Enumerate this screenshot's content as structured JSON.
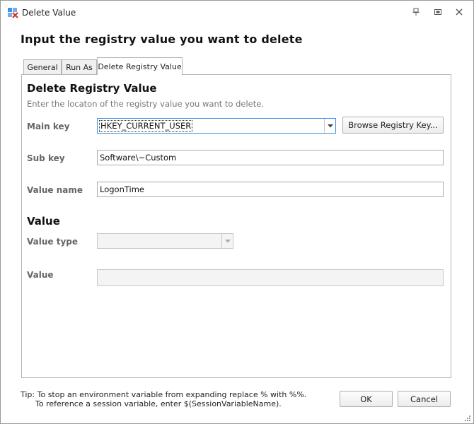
{
  "window": {
    "title": "Delete Value"
  },
  "heading": "Input the registry value you want to delete",
  "tabs": [
    {
      "label": "General"
    },
    {
      "label": "Run As"
    },
    {
      "label": "Delete Registry Value"
    }
  ],
  "registry_section": {
    "title": "Delete Registry Value",
    "description": "Enter the locaton of the registry value you want to delete.",
    "main_key": {
      "label": "Main key",
      "value": "HKEY_CURRENT_USER"
    },
    "browse_button": "Browse Registry Key...",
    "sub_key": {
      "label": "Sub key",
      "value": "Software\\~Custom"
    },
    "value_name": {
      "label": "Value name",
      "value": "LogonTime"
    }
  },
  "value_section": {
    "title": "Value",
    "value_type": {
      "label": "Value type",
      "value": ""
    },
    "value": {
      "label": "Value",
      "value": ""
    }
  },
  "tip": {
    "line1": "Tip: To stop an environment variable from expanding replace % with %%.",
    "line2": "To reference a session variable, enter $(SessionVariableName)."
  },
  "buttons": {
    "ok": "OK",
    "cancel": "Cancel"
  },
  "colors": {
    "border": "#b5b5b5",
    "label_gray": "#666666",
    "description_gray": "#777777"
  }
}
